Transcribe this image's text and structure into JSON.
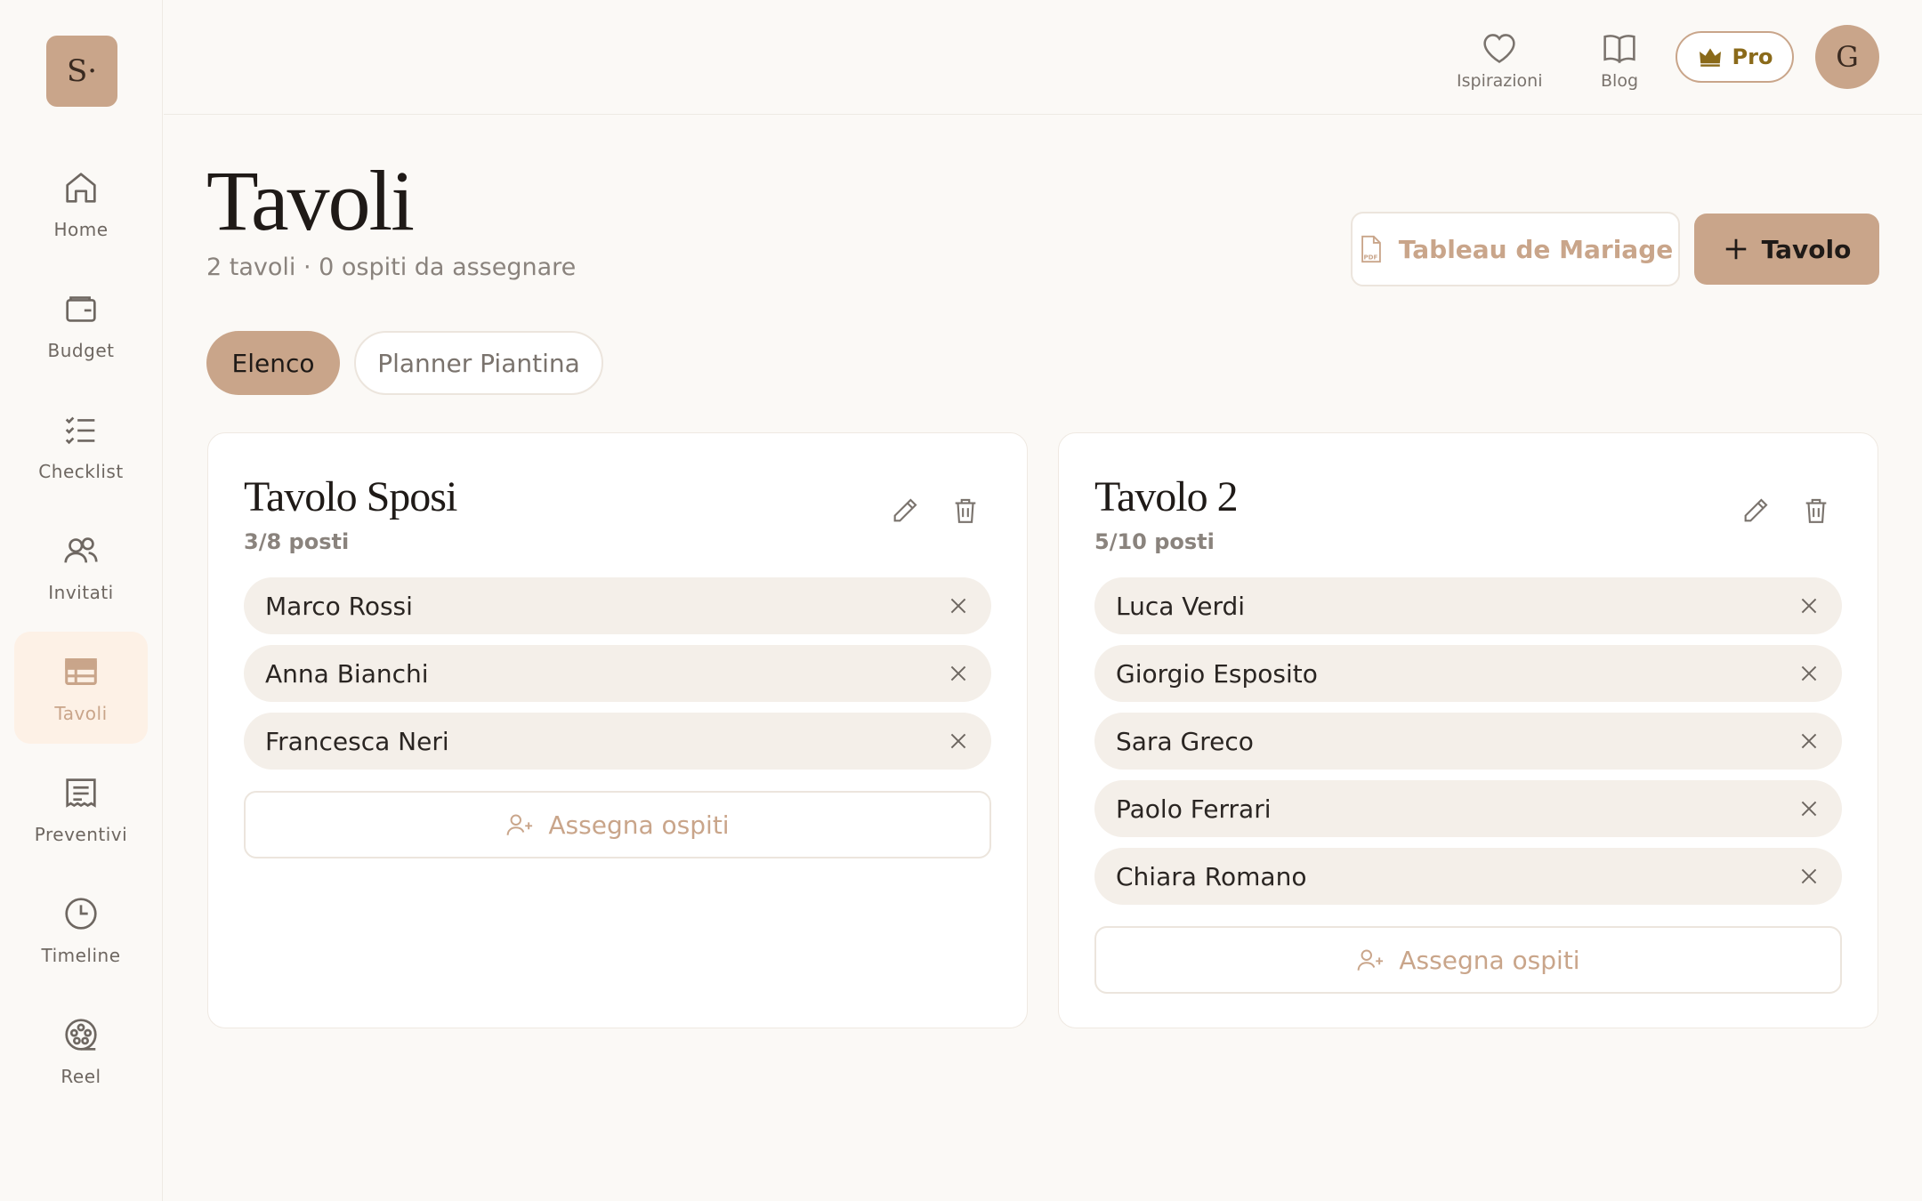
{
  "sidebar": {
    "logo": "S·",
    "items": [
      {
        "label": "Home",
        "icon": "home-icon",
        "active": false
      },
      {
        "label": "Budget",
        "icon": "wallet-icon",
        "active": false
      },
      {
        "label": "Checklist",
        "icon": "checklist-icon",
        "active": false
      },
      {
        "label": "Invitati",
        "icon": "users-icon",
        "active": false
      },
      {
        "label": "Tavoli",
        "icon": "table-icon",
        "active": true
      },
      {
        "label": "Preventivi",
        "icon": "receipt-icon",
        "active": false
      },
      {
        "label": "Timeline",
        "icon": "clock-icon",
        "active": false
      },
      {
        "label": "Reel",
        "icon": "film-reel-icon",
        "active": false
      }
    ]
  },
  "topbar": {
    "inspirations": "Ispirazioni",
    "blog": "Blog",
    "pro": "Pro",
    "avatar": "G"
  },
  "header": {
    "title": "Tavoli",
    "subtitle": "2 tavoli · 0 ospiti da assegnare",
    "tableau_button": "Tableau de Mariage",
    "add_button": "Tavolo"
  },
  "tabs": {
    "list": "Elenco",
    "planner": "Planner Piantina"
  },
  "tables": [
    {
      "name": "Tavolo Sposi",
      "seats": "3/8 posti",
      "guests": [
        "Marco Rossi",
        "Anna Bianchi",
        "Francesca Neri"
      ],
      "assign_label": "Assegna ospiti"
    },
    {
      "name": "Tavolo 2",
      "seats": "5/10 posti",
      "guests": [
        "Luca Verdi",
        "Giorgio Esposito",
        "Sara Greco",
        "Paolo Ferrari",
        "Chiara Romano"
      ],
      "assign_label": "Assegna ospiti"
    }
  ],
  "colors": {
    "accent": "#c9a58a",
    "background": "#fbf9f6",
    "chip": "#f4efe9",
    "pro_text": "#8a6a1a"
  }
}
